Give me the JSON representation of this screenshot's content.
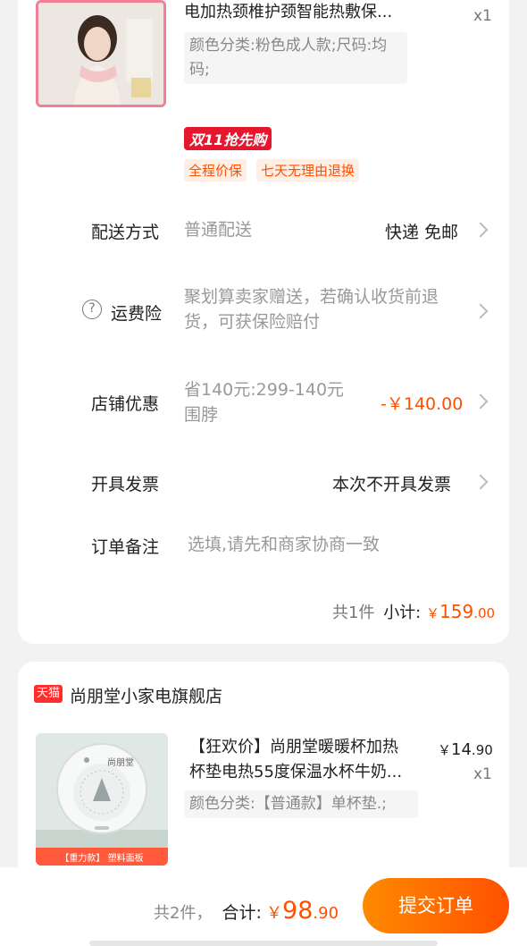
{
  "item1": {
    "title": "电加热颈椎护颈智能热敷保...",
    "spec": "颜色分类:粉色成人款;尺码:均码;",
    "qty": "x1",
    "promo_badge": "双11抢先购",
    "tags": [
      "全程价保",
      "七天无理由退换"
    ]
  },
  "delivery": {
    "label": "配送方式",
    "value": "普通配送",
    "right": "快递 免邮"
  },
  "shipping_insurance": {
    "icon": "?",
    "label": "运费险",
    "value": "聚划算卖家赠送，若确认收货前退货，可获保险赔付"
  },
  "store_discount": {
    "label": "店铺优惠",
    "value": "省140元:299-140元围脖",
    "amount": "-￥140.00"
  },
  "invoice": {
    "label": "开具发票",
    "right": "本次不开具发票"
  },
  "note": {
    "label": "订单备注",
    "placeholder": "选填,请先和商家协商一致"
  },
  "subtotal": {
    "count": "共1件",
    "label": "小计:",
    "currency": "￥",
    "int": "159",
    "dec": ".00"
  },
  "store2": {
    "logo": "天猫",
    "name": "尚朋堂小家电旗舰店",
    "item": {
      "title_line1": "【狂欢价】尚朋堂暖暖杯加热",
      "title_line2": "杯垫电热55度保温水杯牛奶...",
      "spec": "颜色分类:【普通款】单杯垫.;",
      "price_currency": "￥",
      "price_int": "14",
      "price_dec": ".90",
      "qty": "x1",
      "thumb_brand": "尚朋堂",
      "thumb_banner": "【重力款】 塑料面板"
    }
  },
  "bottom": {
    "count": "共2件，",
    "total_label": "合计:",
    "currency": "￥",
    "total_int": "98",
    "total_dec": ".90",
    "submit": "提交订单"
  },
  "colors": {
    "accent": "#ff5000",
    "red": "#e6162e",
    "pink_border": "#f07f98"
  }
}
